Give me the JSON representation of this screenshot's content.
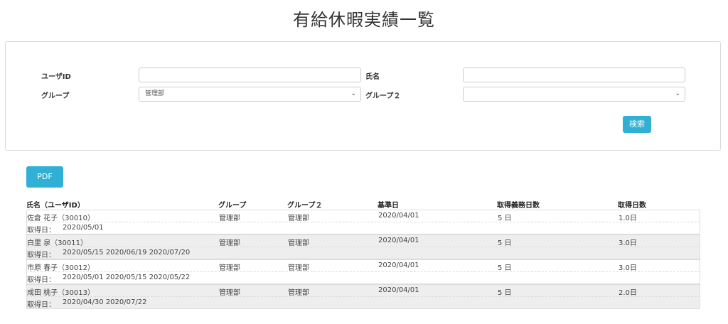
{
  "page": {
    "title": "有給休暇実績一覧"
  },
  "search": {
    "user_id_label": "ユーザID",
    "user_id_value": "",
    "name_label": "氏名",
    "name_value": "",
    "group_label": "グループ",
    "group_value": "管理部",
    "group2_label": "グループ２",
    "group2_value": "",
    "search_button": "検索"
  },
  "actions": {
    "pdf_button": "PDF"
  },
  "table": {
    "headers": [
      "氏名（ユーザID）",
      "グループ",
      "グループ２",
      "基準日",
      "取得義務日数",
      "取得日数"
    ],
    "date_label": "取得日：",
    "rows": [
      {
        "name": "佐倉 花子（30010）",
        "group": "管理部",
        "group2": "管理部",
        "base_date": "2020/04/01",
        "required": "5 日",
        "taken": "1.0日",
        "dates": "2020/05/01"
      },
      {
        "name": "白里 泉（30011）",
        "group": "管理部",
        "group2": "管理部",
        "base_date": "2020/04/01",
        "required": "5 日",
        "taken": "3.0日",
        "dates": "2020/05/15  2020/06/19  2020/07/20"
      },
      {
        "name": "市原 春子（30012）",
        "group": "管理部",
        "group2": "管理部",
        "base_date": "2020/04/01",
        "required": "5 日",
        "taken": "3.0日",
        "dates": "2020/05/01  2020/05/15  2020/05/22"
      },
      {
        "name": "成田 桃子（30013）",
        "group": "管理部",
        "group2": "管理部",
        "base_date": "2020/04/01",
        "required": "5 日",
        "taken": "2.0日",
        "dates": "2020/04/30  2020/07/22"
      }
    ]
  },
  "icons": {
    "select_chevron": "chevron-down-icon"
  },
  "colors": {
    "primary_button": "#31b0d5",
    "shaded_row": "#eeeeee"
  }
}
